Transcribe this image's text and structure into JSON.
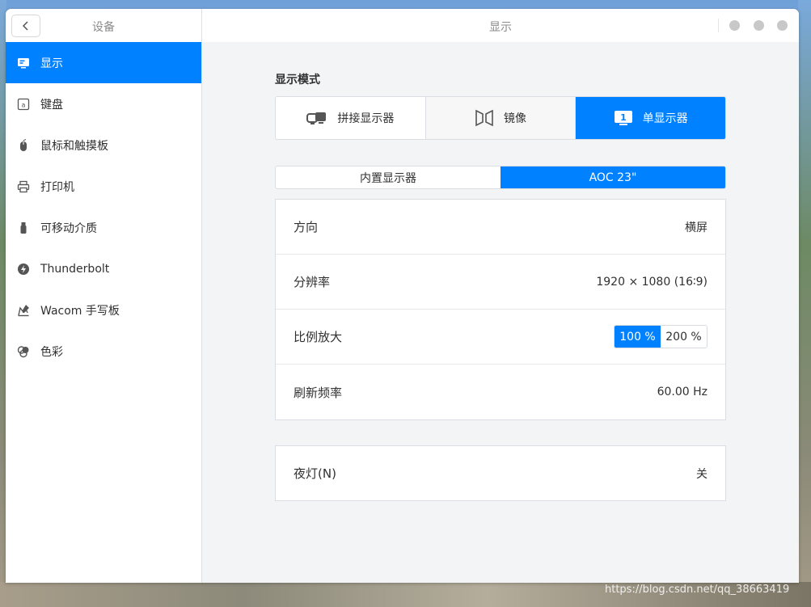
{
  "sidebar": {
    "title": "设备",
    "items": [
      {
        "label": "显示",
        "icon": "display-icon"
      },
      {
        "label": "键盘",
        "icon": "keyboard-icon"
      },
      {
        "label": "鼠标和触摸板",
        "icon": "mouse-icon"
      },
      {
        "label": "打印机",
        "icon": "printer-icon"
      },
      {
        "label": "可移动介质",
        "icon": "usb-drive-icon"
      },
      {
        "label": "Thunderbolt",
        "icon": "thunderbolt-icon"
      },
      {
        "label": "Wacom 手写板",
        "icon": "wacom-tablet-icon"
      },
      {
        "label": "色彩",
        "icon": "color-icon"
      }
    ]
  },
  "window": {
    "title": "显示"
  },
  "display_mode": {
    "title": "显示模式",
    "options": [
      {
        "label": "拼接显示器",
        "icon": "join-displays-icon"
      },
      {
        "label": "镜像",
        "icon": "mirror-icon"
      },
      {
        "label": "单显示器",
        "icon": "single-display-icon",
        "selected": true
      }
    ]
  },
  "monitors": {
    "tabs": [
      {
        "label": "内置显示器"
      },
      {
        "label": "AOC 23\"",
        "selected": true
      }
    ]
  },
  "settings": {
    "orientation": {
      "label": "方向",
      "value": "横屏"
    },
    "resolution": {
      "label": "分辨率",
      "value": "1920 × 1080 (16∶9)"
    },
    "scale": {
      "label": "比例放大",
      "options": [
        "100 %",
        "200 %"
      ],
      "selected": "100 %"
    },
    "refresh_rate": {
      "label": "刷新频率",
      "value": "60.00 Hz"
    }
  },
  "night_light": {
    "label": "夜灯(N)",
    "value": "关"
  },
  "watermark": "https://blog.csdn.net/qq_38663419",
  "colors": {
    "accent": "#0081ff",
    "sidebar_bg": "#ffffff",
    "content_bg": "#f3f4f6"
  }
}
